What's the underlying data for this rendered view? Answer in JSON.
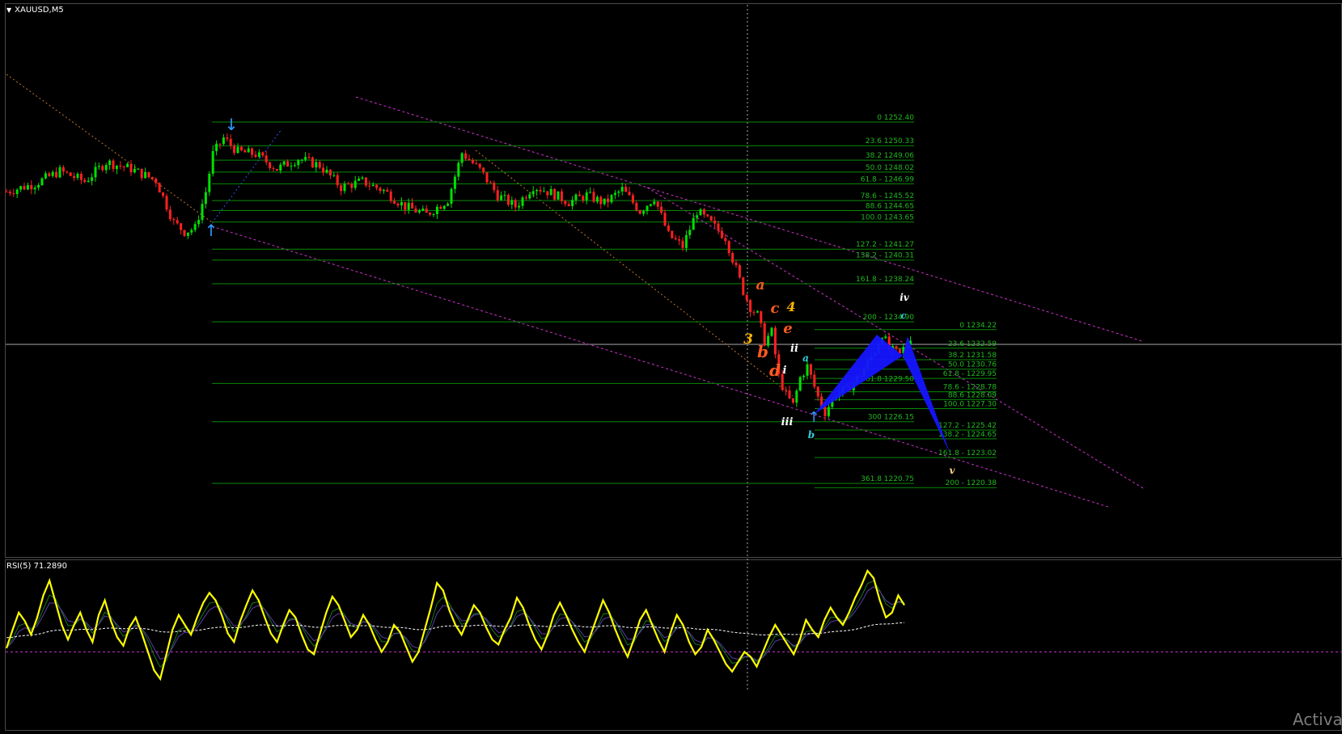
{
  "window": {
    "symbol": "XAUUSD,M5",
    "watermark": "Activat"
  },
  "chart_data": {
    "type": "candlestick",
    "symbol": "XAUUSD",
    "timeframe": "M5",
    "ylim": [
      1219.5,
      1253.5
    ],
    "grid": false,
    "fib_levels_set1": [
      {
        "label": "0 1252.40",
        "price": 1252.4
      },
      {
        "label": "23.6 1250.33",
        "price": 1250.33
      },
      {
        "label": "38.2 1249.06",
        "price": 1249.06
      },
      {
        "label": "50.0 1248.02",
        "price": 1248.02
      },
      {
        "label": "61.8 - 1246.99",
        "price": 1246.99
      },
      {
        "label": "78.6 - 1245.52",
        "price": 1245.52
      },
      {
        "label": "88.6 1244.65",
        "price": 1244.65
      },
      {
        "label": "100.0 1243.65",
        "price": 1243.65
      },
      {
        "label": "127.2 - 1241.27",
        "price": 1241.27
      },
      {
        "label": "138.2 - 1240.31",
        "price": 1240.31
      },
      {
        "label": "161.8 - 1238.24",
        "price": 1238.24
      },
      {
        "label": "200 - 1234.90",
        "price": 1234.9
      },
      {
        "label": "261.8 1229.50",
        "price": 1229.5
      },
      {
        "label": "300 1226.15",
        "price": 1226.15
      },
      {
        "label": "361.8 1220.75",
        "price": 1220.75
      }
    ],
    "fib_levels_set2": [
      {
        "label": "0 1234.22",
        "price": 1234.22
      },
      {
        "label": "23.6 1232.59",
        "price": 1232.59
      },
      {
        "label": "38.2 1231.58",
        "price": 1231.58
      },
      {
        "label": "50.0 1230.76",
        "price": 1230.76
      },
      {
        "label": "61.8 - 1229.95",
        "price": 1229.95
      },
      {
        "label": "78.6 - 1228.78",
        "price": 1228.78
      },
      {
        "label": "88.6 1228.09",
        "price": 1228.09
      },
      {
        "label": "100.0 1227.30",
        "price": 1227.3
      },
      {
        "label": "127.2 - 1225.42",
        "price": 1225.42
      },
      {
        "label": "138.2 - 1224.65",
        "price": 1224.65
      },
      {
        "label": "161.8 - 1223.02",
        "price": 1223.02
      },
      {
        "label": "200 - 1220.38",
        "price": 1220.38
      }
    ],
    "price_path": [
      [
        0,
        1246.3
      ],
      [
        8,
        1247.0
      ],
      [
        15,
        1248.1
      ],
      [
        22,
        1247.2
      ],
      [
        28,
        1248.9
      ],
      [
        35,
        1248.3
      ],
      [
        42,
        1247.3
      ],
      [
        47,
        1243.6
      ],
      [
        50,
        1242.8
      ],
      [
        53,
        1243.1
      ],
      [
        56,
        1246.3
      ],
      [
        58,
        1249.6
      ],
      [
        61,
        1251.0
      ],
      [
        65,
        1249.8
      ],
      [
        70,
        1249.6
      ],
      [
        76,
        1248.3
      ],
      [
        82,
        1249.2
      ],
      [
        88,
        1248.6
      ],
      [
        94,
        1246.7
      ],
      [
        100,
        1247.2
      ],
      [
        106,
        1246.4
      ],
      [
        112,
        1245.0
      ],
      [
        118,
        1244.3
      ],
      [
        124,
        1245.6
      ],
      [
        128,
        1249.7
      ],
      [
        133,
        1248.2
      ],
      [
        138,
        1246.0
      ],
      [
        143,
        1245.0
      ],
      [
        148,
        1246.8
      ],
      [
        153,
        1246.2
      ],
      [
        158,
        1245.4
      ],
      [
        163,
        1246.0
      ],
      [
        168,
        1245.3
      ],
      [
        173,
        1246.5
      ],
      [
        178,
        1244.6
      ],
      [
        182,
        1245.8
      ],
      [
        186,
        1242.5
      ],
      [
        190,
        1241.5
      ],
      [
        194,
        1244.6
      ],
      [
        198,
        1243.5
      ],
      [
        202,
        1242.3
      ],
      [
        205,
        1239.5
      ],
      [
        207,
        1237.6
      ],
      [
        209,
        1236.2
      ],
      [
        211,
        1235.5
      ],
      [
        213,
        1233.2
      ],
      [
        215,
        1234.0
      ],
      [
        217,
        1230.1
      ],
      [
        219,
        1228.5
      ],
      [
        221,
        1227.6
      ],
      [
        223,
        1230.0
      ],
      [
        225,
        1231.0
      ],
      [
        228,
        1228.3
      ],
      [
        230,
        1227.0
      ],
      [
        233,
        1228.6
      ],
      [
        236,
        1229.0
      ],
      [
        240,
        1230.3
      ],
      [
        244,
        1232.4
      ],
      [
        246,
        1233.9
      ],
      [
        248,
        1232.5
      ],
      [
        251,
        1232.0
      ],
      [
        254,
        1233.6
      ]
    ],
    "wave_labels": [
      {
        "text": "a",
        "color": "#ff5a1f"
      },
      {
        "text": "4",
        "color": "#ffb400"
      },
      {
        "text": "c",
        "color": "#ff5a1f"
      },
      {
        "text": "e",
        "color": "#ff5a1f"
      },
      {
        "text": "3",
        "color": "#ffb400"
      },
      {
        "text": "b",
        "color": "#ff5a1f"
      },
      {
        "text": "d",
        "color": "#ff5a1f"
      },
      {
        "text": "ii",
        "color": "#ffffff"
      },
      {
        "text": "i",
        "color": "#ffffff"
      },
      {
        "text": "iii",
        "color": "#ffffff"
      },
      {
        "text": "iv",
        "color": "#ffffff"
      },
      {
        "text": "v",
        "color": "#ffd080"
      },
      {
        "text": "a",
        "color": "#33d0e0"
      },
      {
        "text": "b",
        "color": "#33d0e0"
      },
      {
        "text": "c",
        "color": "#33d0e0"
      }
    ],
    "colors": {
      "bull": "#00e000",
      "bear": "#ff2020",
      "fib": "#0a8a0a",
      "fib_text": "#1fb81f",
      "channel": "#cc33cc",
      "pattern": "#1515ff",
      "rsi": "#ffff00",
      "rsi_ma": "#ffffff",
      "crosshair": "#aaaaaa"
    },
    "rsi": {
      "label": "RSI(5) 71.2890",
      "period": 5,
      "last": 71.289,
      "ylim": [
        0,
        100
      ],
      "values": [
        33,
        48,
        62,
        55,
        44,
        58,
        76,
        88,
        70,
        52,
        40,
        52,
        62,
        48,
        38,
        60,
        72,
        55,
        42,
        35,
        50,
        58,
        45,
        30,
        15,
        8,
        28,
        48,
        60,
        52,
        44,
        58,
        70,
        78,
        72,
        60,
        45,
        38,
        55,
        68,
        80,
        72,
        58,
        45,
        38,
        52,
        64,
        58,
        44,
        32,
        28,
        45,
        62,
        75,
        68,
        55,
        42,
        48,
        60,
        52,
        40,
        30,
        38,
        52,
        46,
        34,
        22,
        30,
        48,
        66,
        86,
        80,
        64,
        52,
        44,
        56,
        68,
        62,
        50,
        40,
        36,
        48,
        58,
        74,
        66,
        52,
        40,
        32,
        44,
        60,
        70,
        60,
        48,
        38,
        30,
        44,
        58,
        72,
        62,
        48,
        36,
        26,
        40,
        56,
        64,
        52,
        40,
        30,
        46,
        60,
        52,
        38,
        28,
        34,
        48,
        40,
        30,
        20,
        14,
        22,
        30,
        26,
        18,
        30,
        42,
        52,
        44,
        36,
        28,
        40,
        56,
        48,
        42,
        56,
        66,
        58,
        52,
        62,
        74,
        84,
        96,
        90,
        72,
        58,
        62,
        76,
        68
      ]
    }
  }
}
